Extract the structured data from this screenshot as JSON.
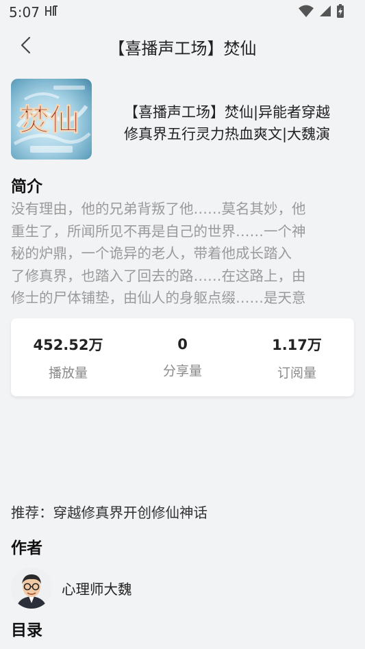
{
  "status_bar": {
    "time": "5:07",
    "carrier_icon": "hd-voice-icon",
    "wifi_icon": "wifi-icon",
    "signal_icon": "signal-icon",
    "battery_icon": "battery-charging-icon"
  },
  "nav": {
    "back_icon": "chevron-left-icon",
    "title": "【喜播声工场】焚仙"
  },
  "album": {
    "cover_text": "焚仙",
    "title_line1": "【喜播声工场】焚仙|异能者穿越",
    "title_line2": "修真界五行灵力热血爽文|大魏演"
  },
  "intro": {
    "heading": "简介",
    "lines": [
      "没有理由，他的兄弟背叛了他……莫名其妙，他",
      "重生了，所闻所见不再是自己的世界……一个神",
      "秘的炉鼎，一个诡异的老人，带着他成长踏入",
      "了修真界，也踏入了回去的路……在这路上，由",
      "修士的尸体铺垫，由仙人的身躯点缀……是天意"
    ]
  },
  "stats": [
    {
      "value": "452.52万",
      "label": "播放量"
    },
    {
      "value": "0",
      "label": "分享量"
    },
    {
      "value": "1.17万",
      "label": "订阅量"
    }
  ],
  "recommend": "推荐：穿越修真界开创修仙神话",
  "author": {
    "heading": "作者",
    "name": "心理师大魏"
  },
  "catalog": {
    "heading": "目录"
  },
  "colors": {
    "background": "#f2f3f5",
    "card": "#ffffff",
    "muted_text": "#9a9a9a"
  }
}
